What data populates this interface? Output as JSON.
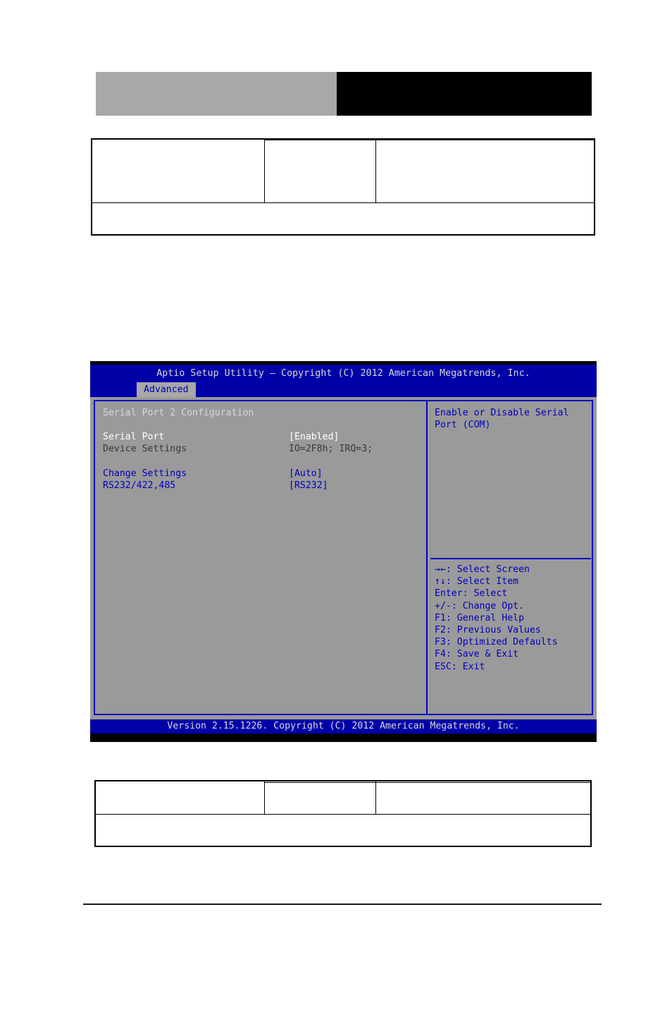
{
  "banner": {
    "gray_color": "#a8a8a8",
    "black_color": "#000000"
  },
  "tables": {
    "top": {
      "rows": [
        {
          "cells": [
            "",
            "",
            ""
          ]
        },
        {
          "cells": [
            "",
            "",
            ""
          ]
        },
        {
          "cells": [
            ""
          ]
        }
      ]
    },
    "bottom": {
      "rows": [
        {
          "cells": [
            "",
            "",
            ""
          ]
        },
        {
          "cells": [
            "",
            "",
            ""
          ]
        },
        {
          "cells": [
            ""
          ]
        }
      ]
    }
  },
  "bios": {
    "title": "Aptio Setup Utility – Copyright (C) 2012 American Megatrends, Inc.",
    "tabs": [
      {
        "label": "Advanced",
        "active": true
      }
    ],
    "section_title": "Serial Port 2 Configuration",
    "settings": [
      {
        "label": "Serial Port",
        "value": "[Enabled]",
        "state": "selected"
      },
      {
        "label": "Device Settings",
        "value": "IO=2F8h; IRQ=3;",
        "state": "dim"
      },
      {
        "label": "Change Settings",
        "value": "[Auto]",
        "state": "link"
      },
      {
        "label": "RS232/422,485",
        "value": "[RS232]",
        "state": "link"
      }
    ],
    "help": {
      "text": "Enable or Disable Serial Port (COM)"
    },
    "hotkeys": [
      {
        "keys": "→←",
        "desc": ": Select Screen"
      },
      {
        "keys": "↑↓",
        "desc": ": Select Item"
      },
      {
        "keys": "Enter",
        "desc": ": Select"
      },
      {
        "keys": "+/-",
        "desc": ": Change Opt."
      },
      {
        "keys": "F1",
        "desc": ": General Help"
      },
      {
        "keys": "F2",
        "desc": ": Previous Values"
      },
      {
        "keys": "F3",
        "desc": ": Optimized Defaults"
      },
      {
        "keys": "F4",
        "desc": ": Save & Exit"
      },
      {
        "keys": "ESC",
        "desc": ": Exit"
      }
    ],
    "version": "Version 2.15.1226. Copyright (C) 2012 American Megatrends, Inc.",
    "colors": {
      "header_blue": "#0000a8",
      "panel_gray": "#9a9a9a",
      "link_blue": "#0000c0",
      "selected_white": "#ffffff",
      "dim_text": "#383838"
    }
  }
}
